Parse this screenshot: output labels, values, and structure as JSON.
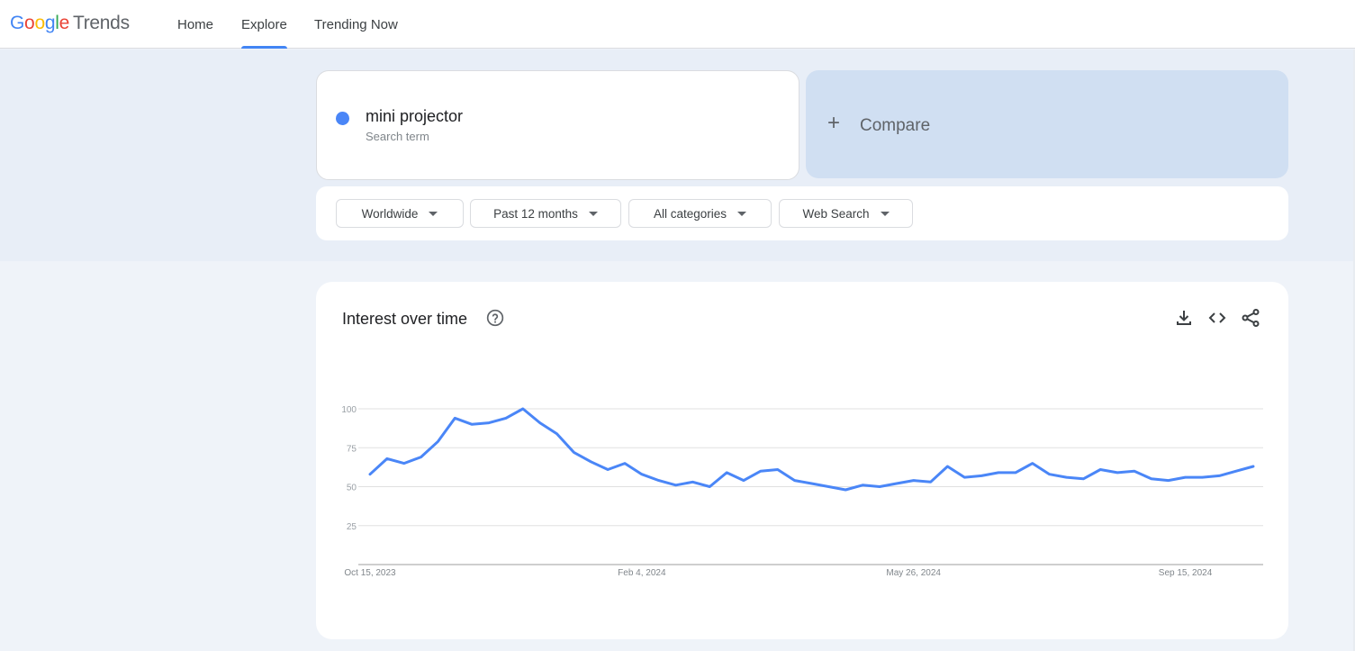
{
  "header": {
    "logo_google": [
      "G",
      "o",
      "o",
      "g",
      "l",
      "e"
    ],
    "logo_product": "Trends",
    "nav": [
      {
        "label": "Home",
        "active": false
      },
      {
        "label": "Explore",
        "active": true
      },
      {
        "label": "Trending Now",
        "active": false
      }
    ]
  },
  "search": {
    "term": "mini projector",
    "term_type": "Search term",
    "term_color": "#4a86f7",
    "compare_label": "Compare",
    "compare_icon": "plus-icon"
  },
  "filters": [
    {
      "label": "Worldwide",
      "icon": "caret-down-icon"
    },
    {
      "label": "Past 12 months",
      "icon": "caret-down-icon"
    },
    {
      "label": "All categories",
      "icon": "caret-down-icon"
    },
    {
      "label": "Web Search",
      "icon": "caret-down-icon"
    }
  ],
  "chart_card": {
    "title": "Interest over time",
    "icons": [
      "help-icon",
      "download-icon",
      "embed-code-icon",
      "share-icon"
    ]
  },
  "chart_data": {
    "type": "line",
    "title": "Interest over time",
    "xlabel": "",
    "ylabel": "",
    "ylim": [
      0,
      100
    ],
    "yticks": [
      25,
      50,
      75,
      100
    ],
    "grid": true,
    "x_start": "2023-10-15",
    "x_interval": "weekly",
    "xtick_labels": [
      {
        "label": "Oct 15, 2023",
        "index": 0
      },
      {
        "label": "Feb 4, 2024",
        "index": 16
      },
      {
        "label": "May 26, 2024",
        "index": 32
      },
      {
        "label": "Sep 15, 2024",
        "index": 48
      }
    ],
    "series": [
      {
        "name": "mini projector",
        "color": "#4a86f7",
        "values": [
          58,
          68,
          65,
          69,
          79,
          94,
          90,
          91,
          94,
          100,
          91,
          84,
          72,
          66,
          61,
          65,
          58,
          54,
          51,
          53,
          50,
          59,
          54,
          60,
          61,
          54,
          52,
          50,
          48,
          51,
          50,
          52,
          54,
          53,
          63,
          56,
          57,
          59,
          59,
          65,
          58,
          56,
          55,
          61,
          59,
          60,
          55,
          54,
          56,
          56,
          57,
          60,
          63
        ]
      }
    ]
  }
}
